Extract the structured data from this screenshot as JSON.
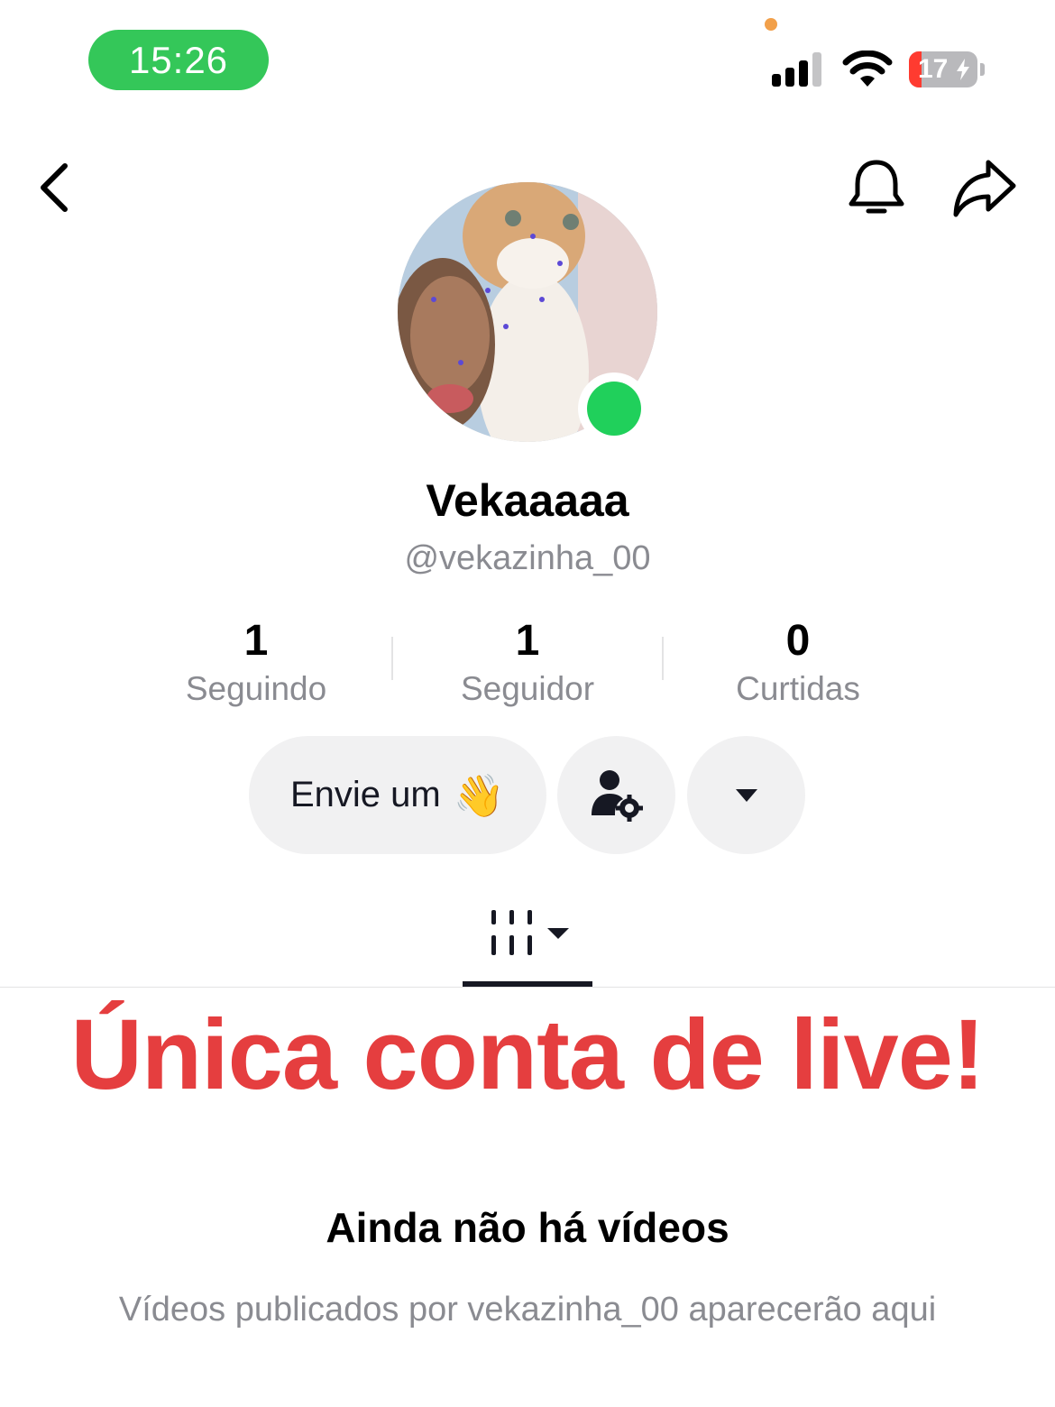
{
  "status_bar": {
    "time": "15:26",
    "battery_percent": "17",
    "icons": [
      "signal-icon",
      "wifi-icon",
      "battery-charging-icon"
    ],
    "time_pill_color": "#34c759"
  },
  "header": {
    "icons": [
      "back-icon",
      "bell-icon",
      "share-icon"
    ]
  },
  "profile": {
    "display_name": "Vekaaaaa",
    "username": "@vekazinha_00",
    "live_status_color": "#20d05b"
  },
  "stats": [
    {
      "value": "1",
      "label": "Seguindo"
    },
    {
      "value": "1",
      "label": "Seguidor"
    },
    {
      "value": "0",
      "label": "Curtidas"
    }
  ],
  "actions": {
    "wave_label": "Envie um",
    "wave_emoji": "👋",
    "friend_icon": "add-friend-settings-icon",
    "more_icon": "caret-down-icon"
  },
  "tabs": {
    "videos_icon": "videos-grid-icon"
  },
  "banner": {
    "text": "Única conta de live!",
    "color": "#e53e3f"
  },
  "empty_state": {
    "title": "Ainda não há vídeos",
    "description": "Vídeos publicados por vekazinha_00 aparecerão aqui"
  }
}
